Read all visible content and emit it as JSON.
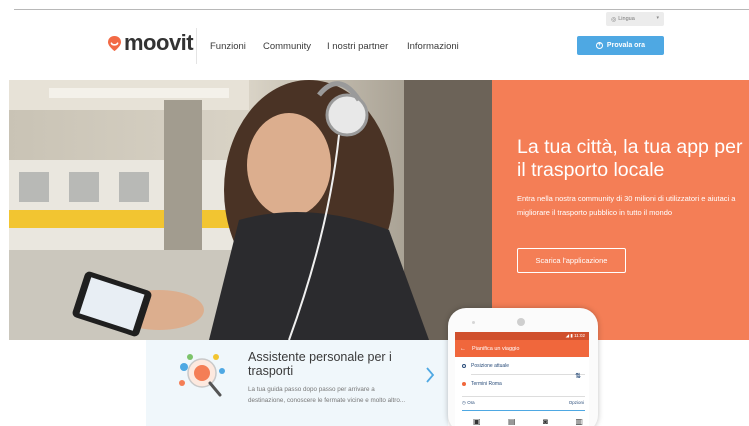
{
  "header": {
    "language": "Lingua",
    "logo_text": "moovit",
    "nav": [
      "Funzioni",
      "Community",
      "I nostri partner",
      "Informazioni"
    ],
    "cta_label": "Provala ora"
  },
  "hero": {
    "title": "La tua città, la tua app per il trasporto locale",
    "subtitle": "Entra nella nostra community di 30 milioni di utilizzatori e aiutaci a migliorare il trasporto pubblico in tutto il mondo",
    "button_label": "Scarica l'applicazione"
  },
  "feature": {
    "title": "Assistente personale per i trasporti",
    "description": "La tua guida passo dopo passo per arrivare a destinazione, conoscere le fermate vicine e molto altro..."
  },
  "phone": {
    "status_time": "11:02",
    "header": "Pianifica un viaggio",
    "origin": "Posizione attuale",
    "destination": "Termini Roma",
    "time_label": "Ora",
    "options_label": "Opzioni"
  },
  "colors": {
    "accent_orange": "#f47e56",
    "cta_blue": "#4ea8e3",
    "logo_pin": "#f26a45"
  }
}
